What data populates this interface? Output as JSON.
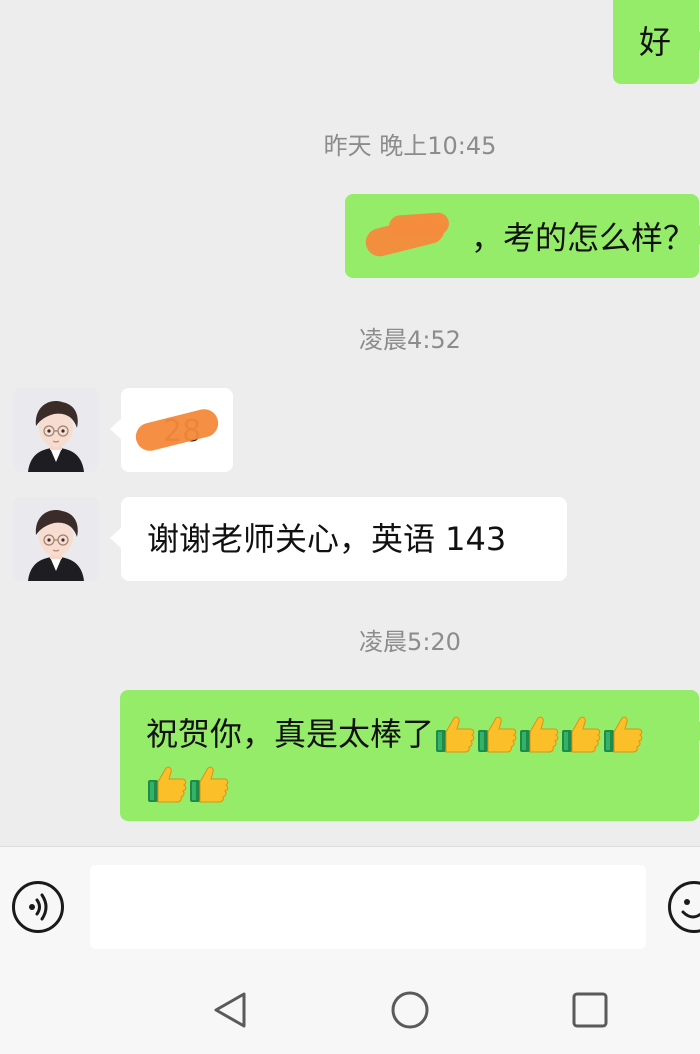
{
  "messages": {
    "m1": {
      "text": "好"
    },
    "ts1": "昨天 晚上10:45",
    "m2": {
      "text_visible": "，考的怎么样？"
    },
    "ts2": "凌晨4:52",
    "m3": {
      "text_visible": "28"
    },
    "m4": {
      "text": "谢谢老师关心，英语 143"
    },
    "ts3": "凌晨5:20",
    "m5": {
      "text": "祝贺你，真是太棒了"
    }
  },
  "colors": {
    "sent_bubble": "#95ec69",
    "received_bubble": "#ffffff",
    "chat_background": "#ededed",
    "redaction": "#f58a3c"
  },
  "icons": {
    "thumbs_up": "thumbs-up-icon",
    "voice": "voice-icon",
    "emoji": "emoji-icon",
    "back": "back-icon",
    "home": "home-icon",
    "recents": "recents-icon"
  }
}
